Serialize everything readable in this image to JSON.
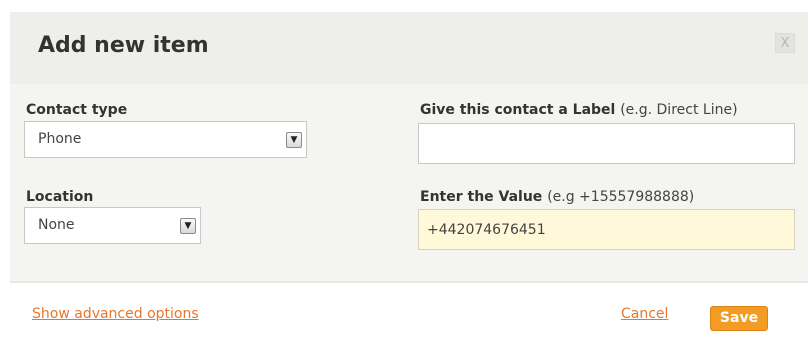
{
  "dialog": {
    "title": "Add new item",
    "close_label": "X"
  },
  "contact_type": {
    "label": "Contact type",
    "selected": "Phone"
  },
  "location": {
    "label": "Location",
    "selected": "None"
  },
  "contact_label": {
    "label": "Give this contact a Label",
    "hint": "(e.g. Direct Line)",
    "value": ""
  },
  "contact_value": {
    "label": "Enter the Value",
    "hint": "(e.g +15557988888)",
    "value": "+442074676451"
  },
  "footer": {
    "advanced_link": "Show advanced options",
    "cancel_link": "Cancel",
    "save_label": "Save"
  },
  "colors": {
    "accent": "#f39b24",
    "link": "#e8762c",
    "header_bg": "#eeeeea",
    "body_bg": "#f4f4f0",
    "highlight_input": "#fff8d9"
  },
  "icons": {
    "close": "close-icon",
    "dropdown": "chevron-down-icon"
  }
}
